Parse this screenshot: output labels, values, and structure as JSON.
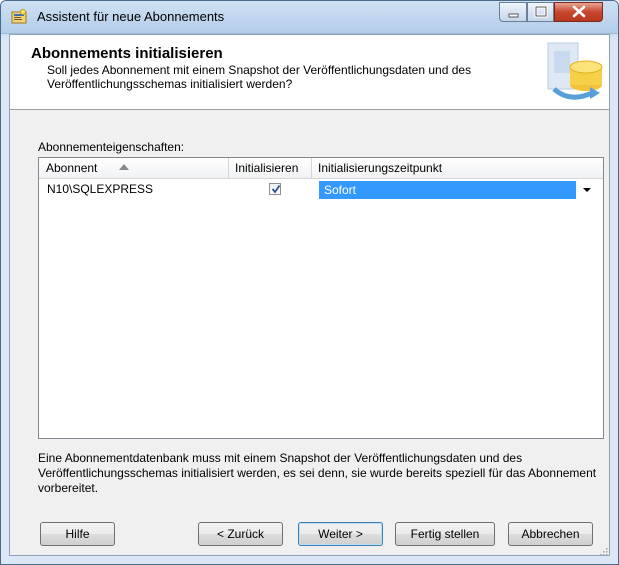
{
  "window": {
    "title": "Assistent für neue Abonnements"
  },
  "header": {
    "title": "Abonnements initialisieren",
    "description": "Soll jedes Abonnement mit einem Snapshot der Veröffentlichungsdaten und des Veröffentlichungsschemas initialisiert werden?"
  },
  "properties": {
    "label": "Abonnementeigenschaften:",
    "columns": [
      "Abonnent",
      "Initialisieren",
      "Initialisierungszeitpunkt"
    ],
    "rows": [
      {
        "subscriber": "N10\\SQLEXPRESS",
        "initialize": true,
        "timing": "Sofort"
      }
    ],
    "sort_column": "Abonnent",
    "sort_direction": "ascending"
  },
  "info": {
    "text": "Eine Abonnementdatenbank muss mit einem Snapshot der Veröffentlichungsdaten und des Veröffentlichungsschemas initialisiert werden, es sei denn, sie wurde bereits speziell für das Abonnement vorbereitet."
  },
  "buttons": {
    "help": "Hilfe",
    "back": "< Zurück",
    "next": "Weiter >",
    "finish": "Fertig stellen",
    "cancel": "Abbrechen"
  },
  "colors": {
    "selection": "#3399ff",
    "close_button": "#c7462d",
    "titlebar": "#b9d1ea"
  },
  "icons": {
    "app": "wizard-app-icon",
    "header": "database-sync-icon",
    "sort": "sort-ascending-icon",
    "dropdown": "dropdown-arrow-icon",
    "check": "checkmark-icon"
  }
}
